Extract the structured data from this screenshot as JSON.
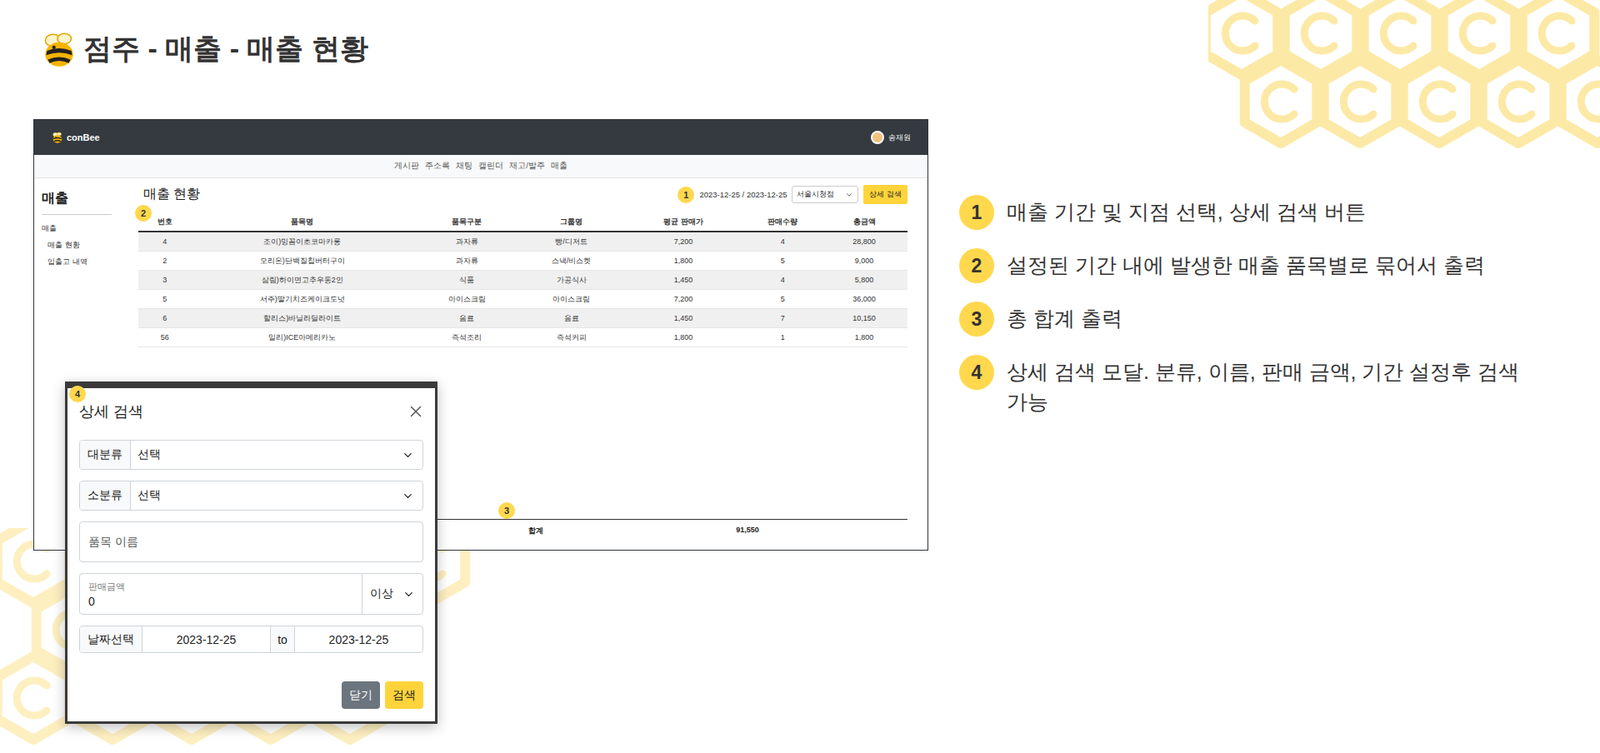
{
  "slide": {
    "title": "점주 - 매출 - 매출 현황"
  },
  "app": {
    "logo": "conBee",
    "user": "송재원",
    "nav": [
      "게시판",
      "주소록",
      "채팅",
      "캘린더",
      "재고/발주",
      "매출"
    ],
    "sidebar": {
      "title": "매출",
      "items": [
        {
          "label": "매출",
          "kind": "group"
        },
        {
          "label": "매출 현황",
          "kind": "item"
        },
        {
          "label": "입출고 내역",
          "kind": "item"
        }
      ]
    },
    "page_title": "매출 현황",
    "period": "2023-12-25 / 2023-12-25",
    "store_select": "서울시청점",
    "detail_button": "상세 검색",
    "table": {
      "columns": [
        "번호",
        "품목명",
        "품목구분",
        "그룹명",
        "평균 판매가",
        "판매수량",
        "총금액"
      ],
      "rows": [
        [
          "4",
          "조이)밍꼼이초코마카롱",
          "과자류",
          "빵/디저트",
          "7,200",
          "4",
          "28,800"
        ],
        [
          "2",
          "오리온)단백질칩버터구이",
          "과자류",
          "스낵/비스켓",
          "1,800",
          "5",
          "9,000"
        ],
        [
          "3",
          "삼림)하이면고추우동2인",
          "식품",
          "가공식사",
          "1,450",
          "4",
          "5,800"
        ],
        [
          "5",
          "서주)딸기치즈케이크도넛",
          "아이스크림",
          "아이스크림",
          "7,200",
          "5",
          "36,000"
        ],
        [
          "6",
          "할리스)바닐라딜라이트",
          "음료",
          "음료",
          "1,450",
          "7",
          "10,150"
        ],
        [
          "56",
          "일리)ICE아메리카노",
          "즉석조리",
          "즉석커피",
          "1,800",
          "1",
          "1,800"
        ]
      ]
    },
    "total": {
      "label": "합계",
      "value": "91,550"
    }
  },
  "modal": {
    "title": "상세 검색",
    "major_category": {
      "label": "대분류",
      "value": "선택"
    },
    "minor_category": {
      "label": "소분류",
      "value": "선택"
    },
    "name_placeholder": "품목 이름",
    "price": {
      "label": "판매금액",
      "value": "0",
      "operator": "이상"
    },
    "date": {
      "label": "날짜선택",
      "from": "2023-12-25",
      "separator": "to",
      "to": "2023-12-25"
    },
    "buttons": [
      {
        "label": "닫기",
        "kind": "secondary"
      },
      {
        "label": "검색",
        "kind": "primary"
      }
    ]
  },
  "badges": [
    "1",
    "2",
    "3",
    "4"
  ],
  "notes": [
    {
      "number": "1",
      "text": "매출 기간 및 지점 선택, 상세 검색 버튼"
    },
    {
      "number": "2",
      "text": "설정된 기간 내에 발생한 매출 품목별로 묶어서 출력"
    },
    {
      "number": "3",
      "text": "총 합계 출력"
    },
    {
      "number": "4",
      "text": "상세 검색 모달. 분류, 이름, 판매 금액, 기간 설정후 검색 가능"
    }
  ]
}
